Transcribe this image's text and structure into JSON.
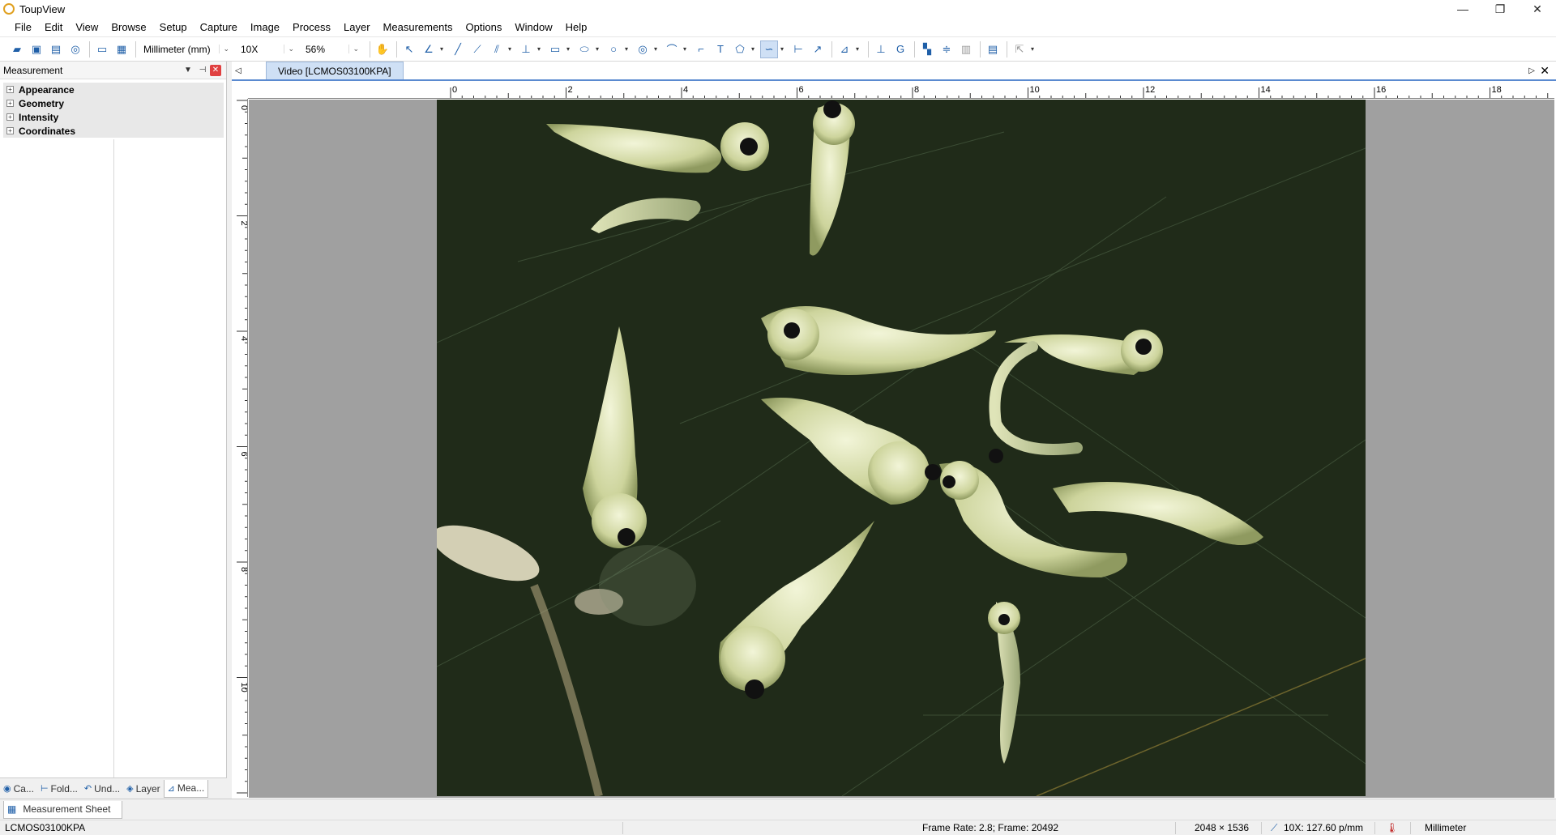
{
  "window": {
    "title": "ToupView",
    "controls": [
      "—",
      "❐",
      "✕"
    ]
  },
  "menu": [
    "File",
    "Edit",
    "View",
    "Browse",
    "Setup",
    "Capture",
    "Image",
    "Process",
    "Layer",
    "Measurements",
    "Options",
    "Window",
    "Help"
  ],
  "toolbar": {
    "unit": "Millimeter (mm)",
    "magnification": "10X",
    "zoom": "56%"
  },
  "left_panel": {
    "title": "Measurement",
    "groups": [
      "Appearance",
      "Geometry",
      "Intensity",
      "Coordinates"
    ],
    "tabs": [
      "Ca...",
      "Fold...",
      "Und...",
      "Layer",
      "Mea..."
    ]
  },
  "document": {
    "tab": "Video [LCMOS03100KPA]"
  },
  "ruler": {
    "h_labels": [
      "0",
      "2",
      "4",
      "6",
      "8",
      "10",
      "12",
      "14",
      "16",
      "18"
    ],
    "v_labels": [
      "0",
      "2",
      "4",
      "6",
      "8",
      "10"
    ]
  },
  "bottom": {
    "sheet_tab": "Measurement Sheet"
  },
  "status": {
    "camera": "LCMOS03100KPA",
    "frame_info": "Frame Rate: 2.8; Frame: 20492",
    "resolution": "2048 × 1536",
    "calibration": "10X: 127.60 p/mm",
    "unit": "Millimeter"
  },
  "colors": {
    "accent": "#1f5fa8",
    "tab_active": "#cfe0f5",
    "close_red": "#e04040"
  },
  "icons": [
    "app-icon",
    "open-icon",
    "save-icon",
    "pan-hand-icon",
    "arrow-select-icon",
    "line-icon",
    "rectangle-icon",
    "ellipse-icon",
    "circle-icon",
    "text-icon",
    "polygon-icon",
    "calibrate-icon",
    "export-icon"
  ]
}
